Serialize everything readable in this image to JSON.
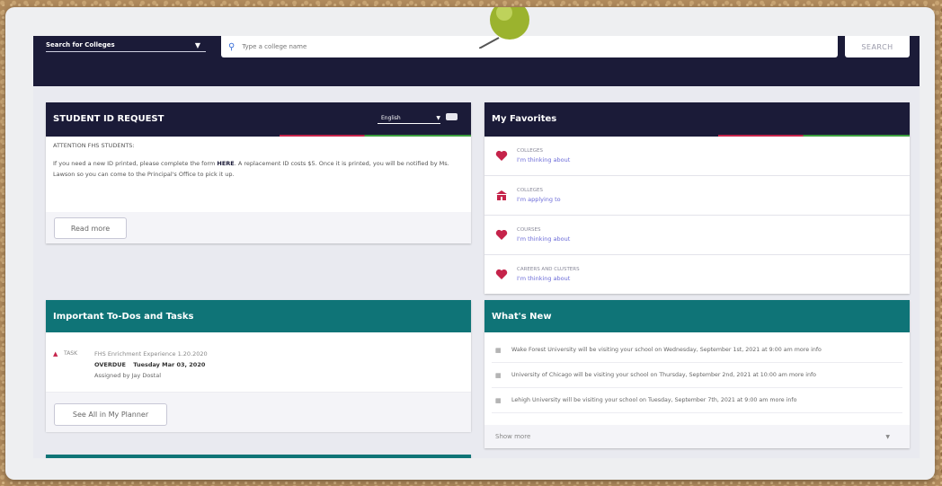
{
  "search": {
    "select_label": "Search for Colleges",
    "placeholder": "Type a college name",
    "button": "SEARCH"
  },
  "student_id": {
    "title": "STUDENT ID REQUEST",
    "language": "English",
    "attention": "ATTENTION FHS STUDENTS:",
    "body_before": "If you need a new ID printed, please complete the form ",
    "link": "HERE",
    "body_after": ". A replacement ID costs $5. Once it is printed, you will be notified by Ms. Lawson so you can come to the Principal's Office to pick it up.",
    "read_more": "Read more"
  },
  "favorites": {
    "title": "My Favorites",
    "items": [
      {
        "category": "COLLEGES",
        "link": "I'm thinking about",
        "icon": "heart-icon"
      },
      {
        "category": "COLLEGES",
        "link": "I'm applying to",
        "icon": "building-icon"
      },
      {
        "category": "COURSES",
        "link": "I'm thinking about",
        "icon": "heart-icon"
      },
      {
        "category": "CAREERS AND CLUSTERS",
        "link": "I'm thinking about",
        "icon": "heart-icon"
      }
    ]
  },
  "todos": {
    "title": "Important To-Dos and Tasks",
    "task_label": "TASK",
    "task_name": "FHS Enrichment Experience 1.20.2020",
    "overdue_label": "OVERDUE",
    "due_date": "Tuesday Mar 03, 2020",
    "assigned": "Assigned by Jay Dostal",
    "see_all": "See All in My Planner"
  },
  "whats_new": {
    "title": "What's New",
    "items": [
      "Wake Forest University will be visiting your school on Wednesday, September 1st, 2021 at 9:00 am more info",
      "University of Chicago will be visiting your school on Thursday, September 2nd, 2021 at 10:00 am more info",
      "Lehigh University will be visiting your school on Tuesday, September 7th, 2021 at 9:00 am more info"
    ],
    "show_more": "Show more"
  },
  "colors": {
    "navy": "#1b1b38",
    "teal": "#0f7477",
    "accent": "#c5234a",
    "link": "#6b6bd8"
  }
}
